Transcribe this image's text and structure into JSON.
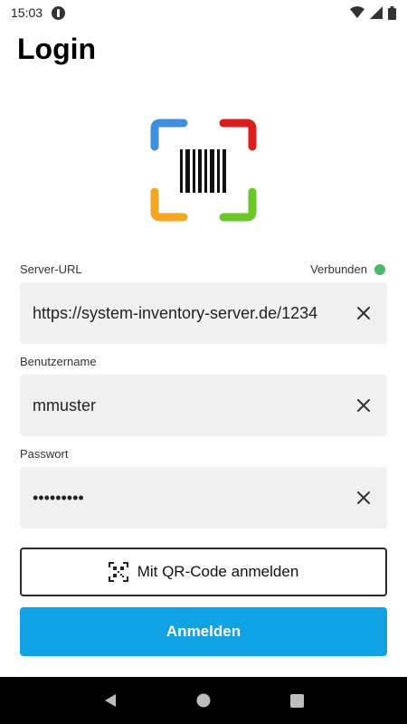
{
  "status_bar": {
    "time": "15:03",
    "icons": [
      "app-notification-icon",
      "wifi-icon",
      "signal-icon",
      "battery-icon"
    ]
  },
  "page": {
    "title": "Login"
  },
  "logo": {
    "name": "barcode-scanner-logo",
    "colors": {
      "top_left": "#3d8fe0",
      "top_right": "#d81e1e",
      "bottom_left": "#f5a623",
      "bottom_right": "#6cc72b",
      "barcode": "#111111"
    }
  },
  "form": {
    "server_url": {
      "label": "Server-URL",
      "value": "https://system-inventory-server.de/1234",
      "status_text": "Verbunden",
      "status_color": "#4cb86b"
    },
    "username": {
      "label": "Benutzername",
      "value": "mmuster"
    },
    "password": {
      "label": "Passwort",
      "value": "•••••••••"
    }
  },
  "buttons": {
    "qr_login": "Mit QR-Code anmelden",
    "login": "Anmelden",
    "login_color": "#10a2e2"
  },
  "nav_bar": {
    "items": [
      "back-icon",
      "home-icon",
      "recents-icon"
    ]
  }
}
